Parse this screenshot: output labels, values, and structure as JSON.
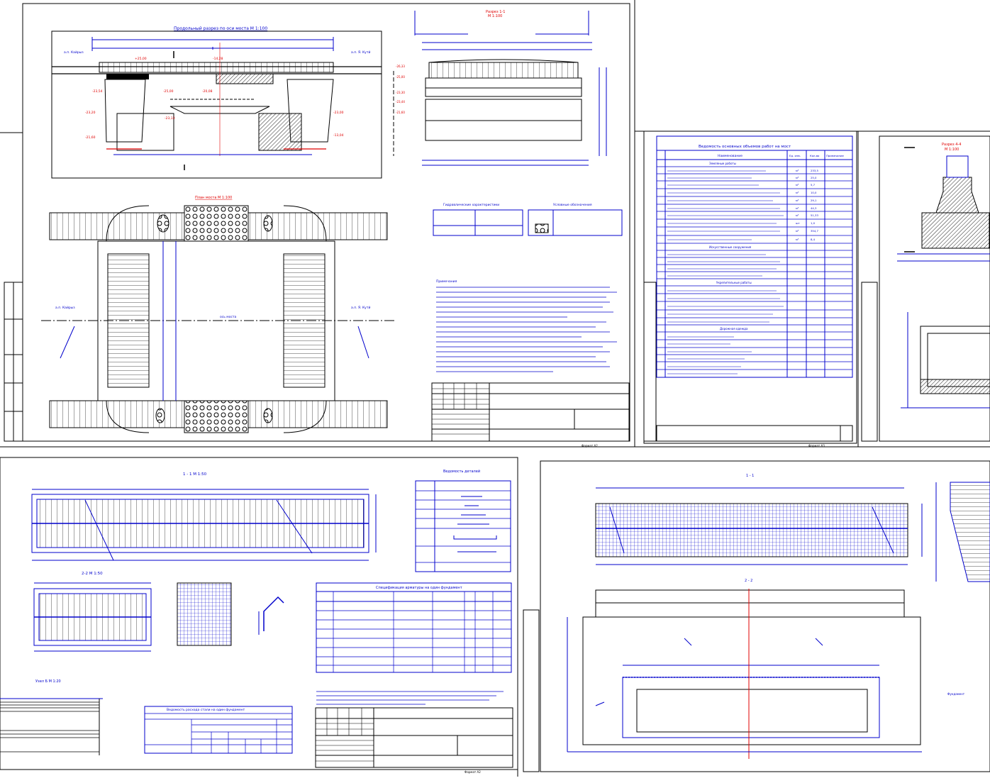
{
  "sheet1": {
    "elevation_title": "Продольный разрез по оси моста М 1:100",
    "plan_title": "План моста М 1:100",
    "section_title": "Разрез 1-1",
    "section_scale": "М 1:100",
    "label_left": "а.п. Кайрыз",
    "label_right": "а.п. Я. Кутй",
    "axis_label": "ось моста",
    "specs_title": "Гидравлические характеристики",
    "legend_title": "Условные обозначения",
    "notes_title": "Примечания",
    "sheet_label": "Формат А2"
  },
  "sheet2": {
    "title": "Ведомость основных объемов работ на мост",
    "col_name": "Наименование",
    "col_unit": "Ед. изм.",
    "col_qty": "Кол-во",
    "col_note": "Примечание",
    "sections": [
      "Земляные работы",
      "Искусственные сооружения",
      "Укрепительные работы",
      "Дорожная одежда"
    ],
    "units": [
      "м³",
      "м³",
      "м³",
      "м³",
      "м³",
      "м³",
      "м³",
      "шт",
      "м³",
      "м³"
    ],
    "qtys": [
      "233,5",
      "25,0",
      "5,7",
      "10,0",
      "29,1",
      "44,3",
      "51,33",
      "1,0",
      "354,7",
      "8,4"
    ],
    "sheet_label": "Формат А3"
  },
  "sheet3": {
    "section_title": "Разрез 4-4",
    "section_scale": "М 1:100"
  },
  "sheet4": {
    "view1_title": "1 - 1   М 1:50",
    "view2_title": "2-2 М 1:50",
    "details_title": "Ведомость деталей",
    "rebar_title": "Ведомость расхода стали на один фундамент",
    "spec_title": "Спецификация арматуры на один фундамент",
    "node_title": "Узел Б   М 1:20",
    "sheet_label": "Формат А2"
  },
  "sheet5": {
    "view1_title": "1 - 1",
    "view2_title": "2 - 2",
    "note_label": "Фундамент"
  },
  "colors": {
    "line": "#0000cc",
    "axis": "#e00000",
    "hatch": "#333333",
    "paper": "#ffffff"
  }
}
